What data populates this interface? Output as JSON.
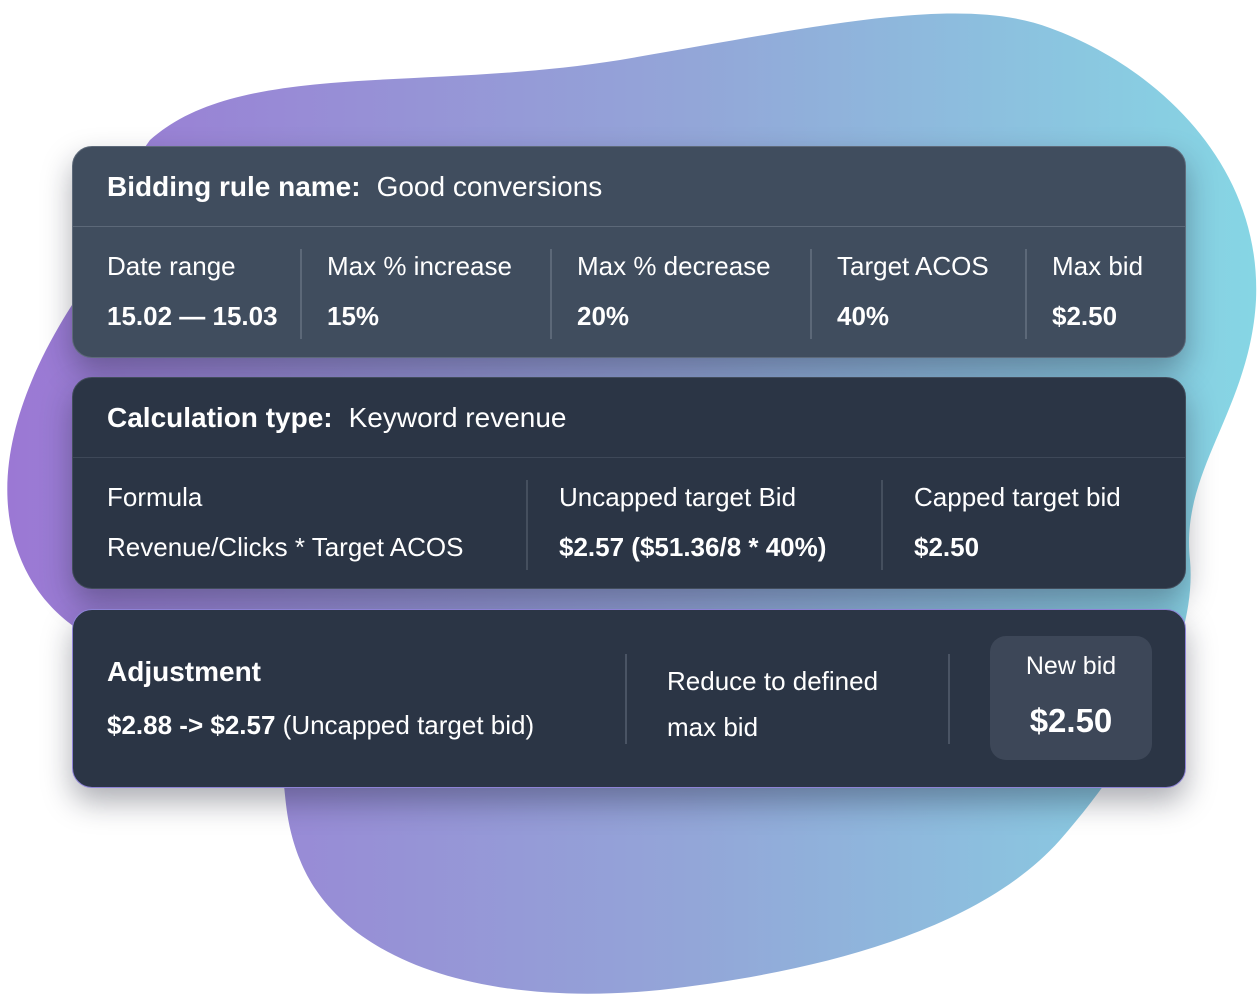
{
  "colors": {
    "blob_start": "#9b78d4",
    "blob_end": "#8ad3e3",
    "card_light": "#404d5e",
    "card_dark": "#2b3545",
    "highlight_border": "#8e83d6"
  },
  "rule": {
    "name_label": "Bidding rule name:",
    "name_value": "Good conversions",
    "columns": [
      {
        "label": "Date range",
        "value": "15.02 — 15.03"
      },
      {
        "label": "Max % increase",
        "value": "15%"
      },
      {
        "label": "Max % decrease",
        "value": "20%"
      },
      {
        "label": "Target ACOS",
        "value": "40%"
      },
      {
        "label": "Max bid",
        "value": "$2.50"
      }
    ]
  },
  "calculation": {
    "type_label": "Calculation type:",
    "type_value": "Keyword revenue",
    "columns": [
      {
        "label": "Formula",
        "value": "Revenue/Clicks * Target ACOS"
      },
      {
        "label": "Uncapped target Bid",
        "value": "$2.57 ($51.36/8 * 40%)"
      },
      {
        "label": "Capped target bid",
        "value": "$2.50"
      }
    ]
  },
  "adjustment": {
    "title": "Adjustment",
    "change": "$2.88 -> $2.57",
    "change_note": "(Uncapped target bid)",
    "action_line1": "Reduce to defined",
    "action_line2": "max bid",
    "new_bid_label": "New bid",
    "new_bid_value": "$2.50"
  }
}
